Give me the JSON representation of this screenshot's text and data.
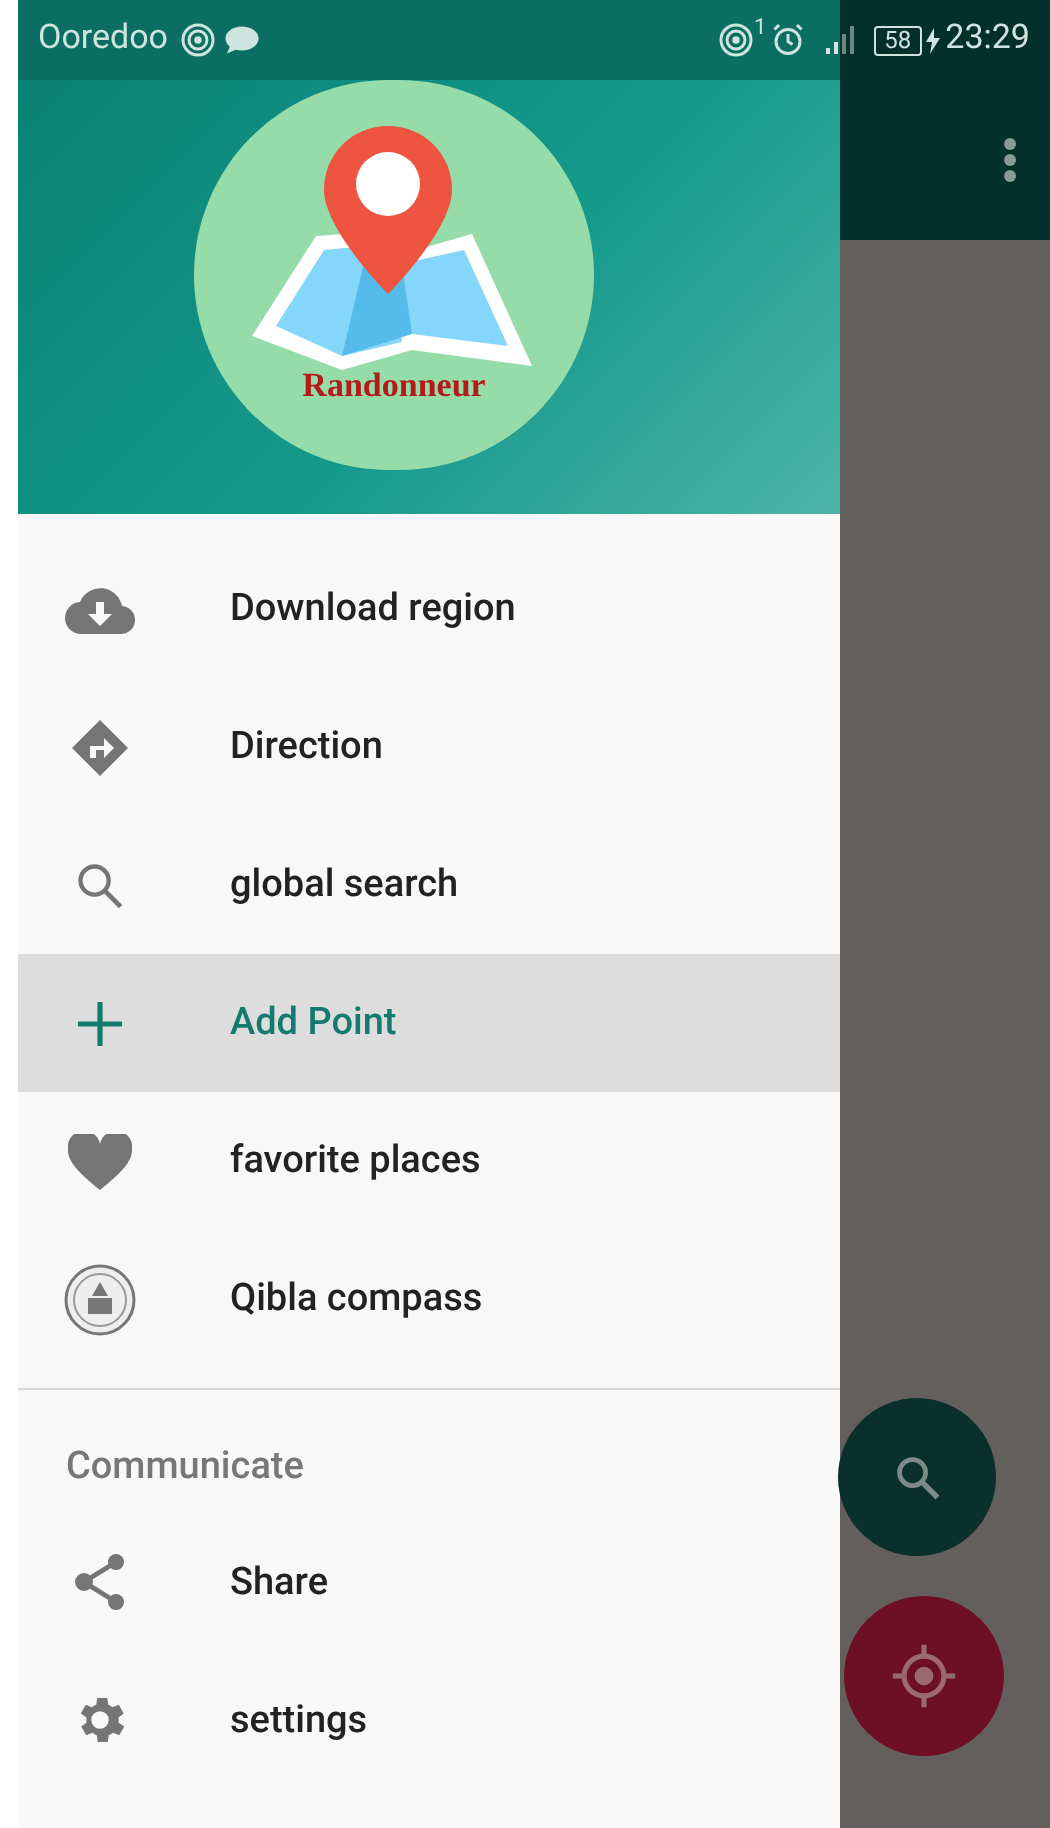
{
  "status_bar": {
    "carrier": "Ooredoo",
    "hotspot_count": "1",
    "battery": "58",
    "time": "23:29"
  },
  "drawer": {
    "logo_text": "Randonneur",
    "items": [
      {
        "label": "Download region",
        "selected": false
      },
      {
        "label": "Direction",
        "selected": false
      },
      {
        "label": "global search",
        "selected": false
      },
      {
        "label": "Add Point",
        "selected": true
      },
      {
        "label": "favorite places",
        "selected": false
      },
      {
        "label": "Qibla compass",
        "selected": false
      }
    ],
    "section": {
      "title": "Communicate",
      "items": [
        {
          "label": "Share",
          "selected": false
        },
        {
          "label": "settings",
          "selected": false
        }
      ]
    }
  }
}
